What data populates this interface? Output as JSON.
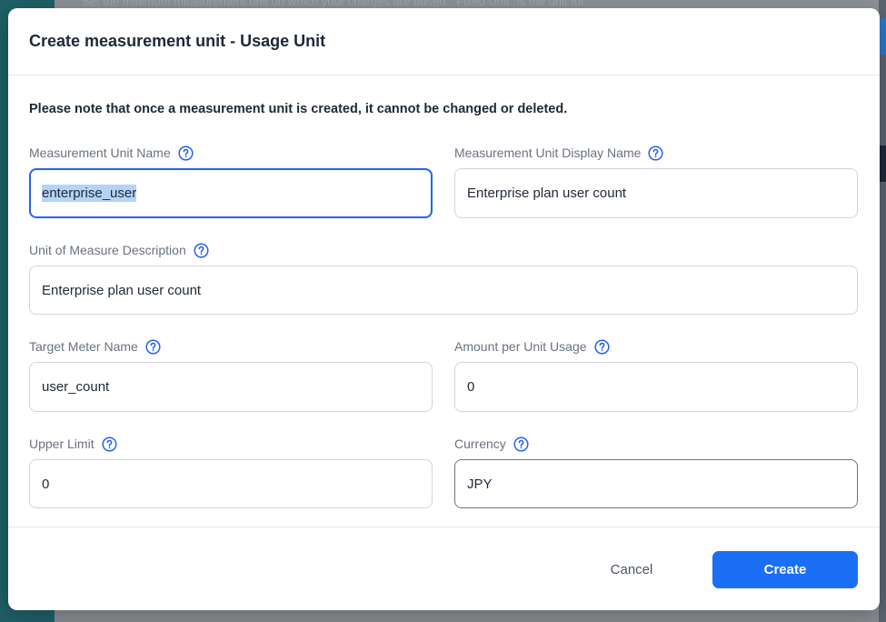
{
  "backdrop": {
    "partial_text": "Set the minimum measurement unit on which your charges are based. \"Fixed Unit\" is the unit for"
  },
  "modal": {
    "title": "Create measurement unit - Usage Unit",
    "note": "Please note that once a measurement unit is created, it cannot be changed or deleted.",
    "fields": {
      "unit_name": {
        "label": "Measurement Unit Name",
        "value": "enterprise_user"
      },
      "display_name": {
        "label": "Measurement Unit Display Name",
        "value": "Enterprise plan user count"
      },
      "description": {
        "label": "Unit of Measure Description",
        "value": "Enterprise plan user count"
      },
      "meter_name": {
        "label": "Target Meter Name",
        "value": "user_count"
      },
      "amount_per_unit": {
        "label": "Amount per Unit Usage",
        "value": "0"
      },
      "upper_limit": {
        "label": "Upper Limit",
        "value": "0"
      },
      "currency": {
        "label": "Currency",
        "value": "JPY"
      }
    },
    "footer": {
      "cancel_label": "Cancel",
      "create_label": "Create"
    }
  },
  "colors": {
    "accent": "#1a6ff5",
    "focus_border": "#2563eb",
    "help_icon": "#2563eb"
  },
  "icons": {
    "help": "question-circle-icon"
  }
}
